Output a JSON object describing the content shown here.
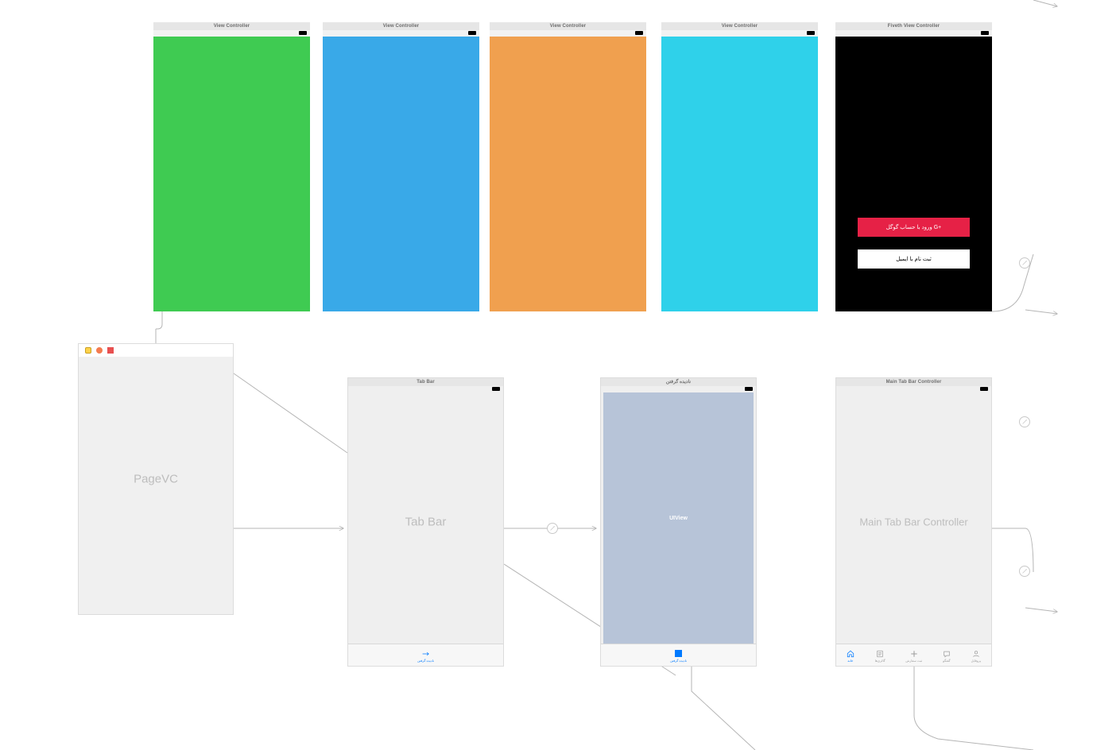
{
  "top_scenes": [
    {
      "title": "View Controller",
      "color": "#3fcb52"
    },
    {
      "title": "View Controller",
      "color": "#39a9e8"
    },
    {
      "title": "View Controller",
      "color": "#f0a04f"
    },
    {
      "title": "View Controller",
      "color": "#2fd1ea"
    },
    {
      "title": "Fiveth View Controller",
      "color": "#000000"
    }
  ],
  "login": {
    "google_label": "ورود با حساب گوگل  G+",
    "email_label": "ثبت نام با ایمیل"
  },
  "pagevc": {
    "label": "PageVC"
  },
  "tabbar_scene": {
    "title": "Tab Bar",
    "center_label": "Tab Bar",
    "tab_label": "نادیده گرفتن"
  },
  "ignore_scene": {
    "title": "نادیده گرفتن",
    "view_label": "UIView",
    "tab_label": "نادیده گرفتن"
  },
  "maintab_scene": {
    "title": "Main Tab Bar Controller",
    "center_label": "Main Tab Bar Controller",
    "tabs": [
      {
        "label": "خانه"
      },
      {
        "label": "گالری‌ها"
      },
      {
        "label": "ثبت سفارش"
      },
      {
        "label": "گفتگو"
      },
      {
        "label": "پروفایل"
      }
    ]
  }
}
